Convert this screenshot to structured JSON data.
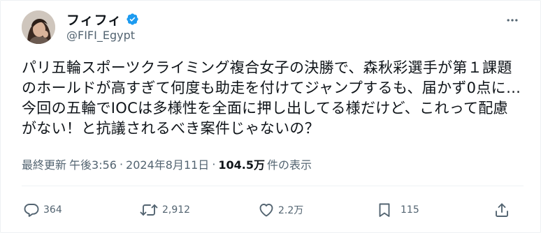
{
  "user": {
    "display_name": "フィフィ",
    "handle": "@FIFI_Egypt",
    "verified": true
  },
  "tweet": {
    "lines": [
      "パリ五輪スポーツクライミング複合女子の決勝で、森秋彩選手が第１課題",
      "のホールドが高すぎて何度も助走を付けてジャンプするも、届かず0点に…",
      "今回の五輪でIOCは多様性を全面に押し出してる様だけど、これって配慮",
      "がない！と抗議されるべき案件じゃないの？"
    ]
  },
  "meta": {
    "updated_label": "最終更新",
    "time": "午後3:56",
    "date": "2024年8月11日",
    "views_count": "104.5万",
    "views_label": "件の表示"
  },
  "actions": {
    "replies": "364",
    "reposts": "2,912",
    "likes": "2.2万",
    "bookmarks": "115"
  },
  "icons": {
    "more": "more-horizontal-icon",
    "reply": "reply-bubble-icon",
    "repost": "repost-arrows-icon",
    "like": "heart-icon",
    "bookmark": "bookmark-icon",
    "share": "share-icon",
    "verified": "verified-badge-icon"
  },
  "colors": {
    "verified": "#1d9bf0",
    "text": "#0f1419",
    "muted": "#536471"
  }
}
